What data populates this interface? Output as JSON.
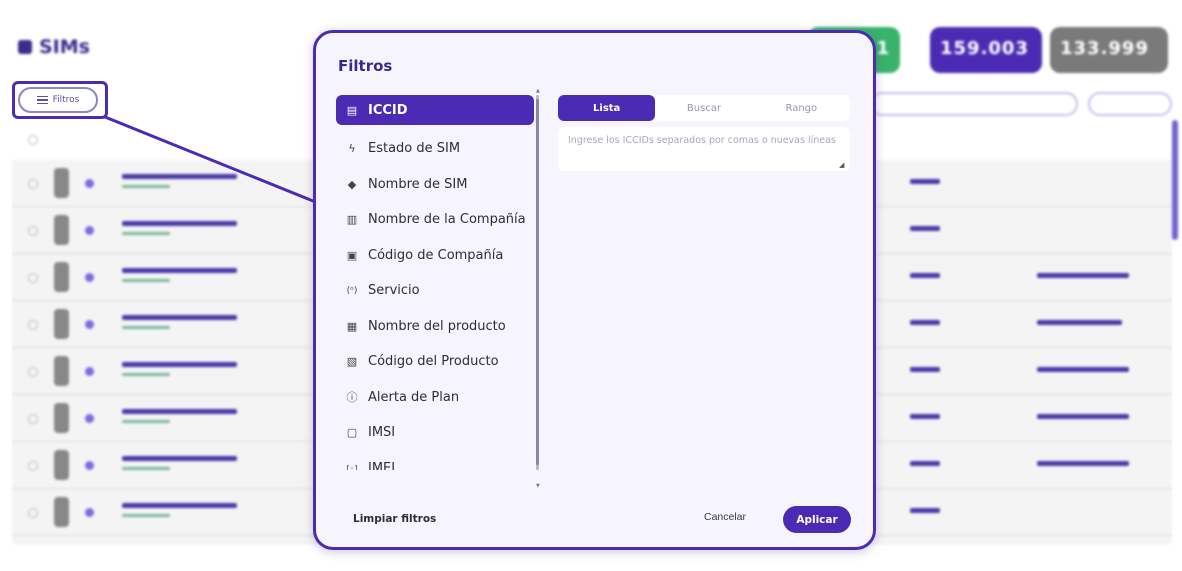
{
  "page": {
    "title": "SIMs",
    "filters_button_label": "Filtros"
  },
  "stats": [
    {
      "value": "1",
      "color": "#39b36b"
    },
    {
      "value": "159.003",
      "color": "#4b2bb3"
    },
    {
      "value": "133.999",
      "color": "#7a7a7a"
    }
  ],
  "filter_modal": {
    "title": "Filtros",
    "menu_items": [
      {
        "label": "ICCID",
        "icon": "document-icon",
        "active": true
      },
      {
        "label": "Estado de SIM",
        "icon": "lightning-icon",
        "active": false
      },
      {
        "label": "Nombre de SIM",
        "icon": "tag-icon",
        "active": false
      },
      {
        "label": "Nombre de la Compañía",
        "icon": "building-icon",
        "active": false
      },
      {
        "label": "Código de Compañía",
        "icon": "company-code-icon",
        "active": false
      },
      {
        "label": "Servicio",
        "icon": "broadcast-icon",
        "active": false
      },
      {
        "label": "Nombre del producto",
        "icon": "gift-icon",
        "active": false
      },
      {
        "label": "Código del Producto",
        "icon": "barcode-icon",
        "active": false
      },
      {
        "label": "Alerta de Plan",
        "icon": "alert-icon",
        "active": false
      },
      {
        "label": "IMSI",
        "icon": "chat-icon",
        "active": false
      },
      {
        "label": "IMEI",
        "icon": "scan-icon",
        "active": false
      }
    ],
    "tabs": [
      {
        "label": "Lista",
        "active": true
      },
      {
        "label": "Buscar",
        "active": false
      },
      {
        "label": "Rango",
        "active": false
      }
    ],
    "input_placeholder": "Ingrese los ICCIDs separados por comas o nuevas líneas",
    "clear_label": "Limpiar filtros",
    "cancel_label": "Cancelar",
    "apply_label": "Aplicar",
    "accent_color": "#4b2bb3"
  }
}
